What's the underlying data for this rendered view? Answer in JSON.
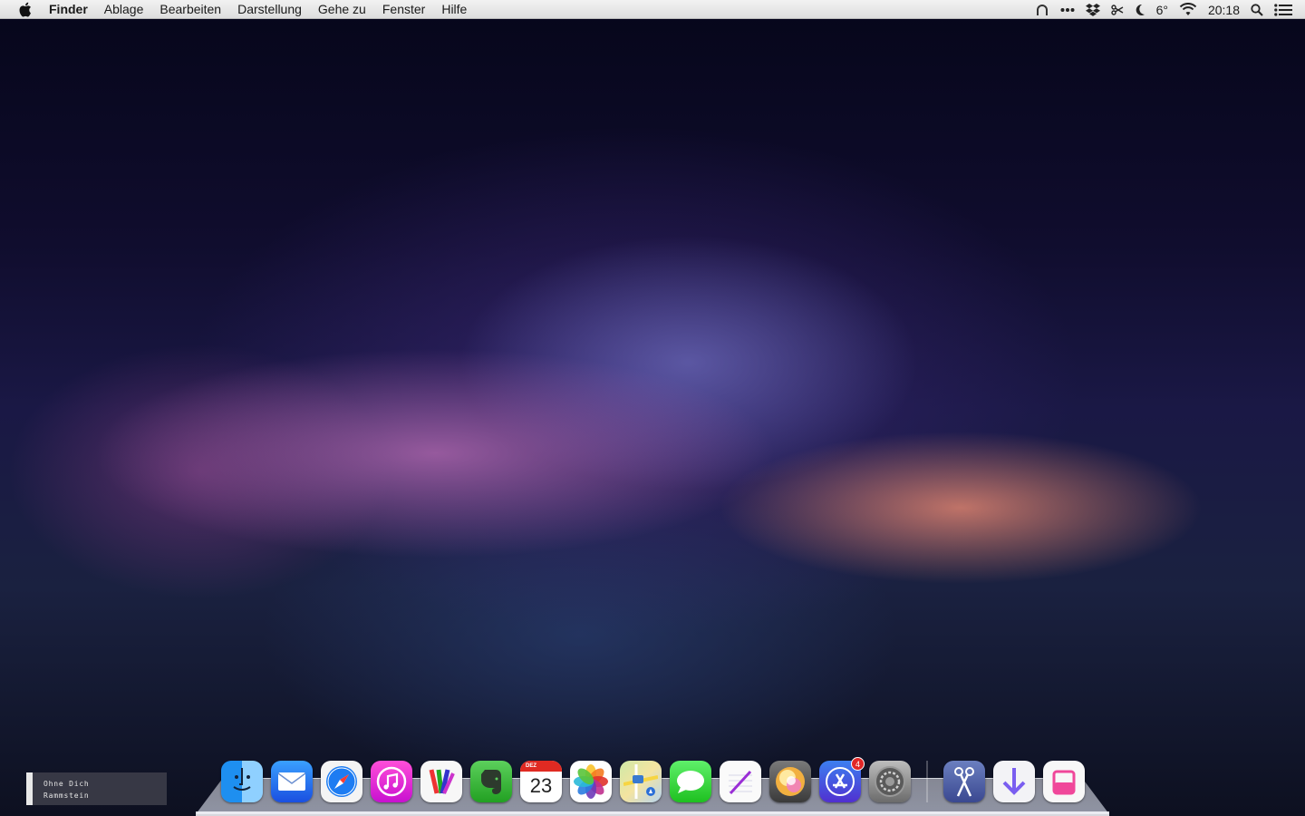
{
  "menubar": {
    "app_name": "Finder",
    "items": [
      "Ablage",
      "Bearbeiten",
      "Darstellung",
      "Gehe zu",
      "Fenster",
      "Hilfe"
    ],
    "temperature": "6°",
    "time": "20:18"
  },
  "now_playing": {
    "title": "Ohne Dich",
    "artist": "Rammstein"
  },
  "dock": {
    "calendar_month": "DEZ",
    "calendar_day": "23",
    "app_store_badge": "4"
  },
  "colors": {
    "badge": "#e12727",
    "menubar_bg": "#e8e8e8"
  }
}
